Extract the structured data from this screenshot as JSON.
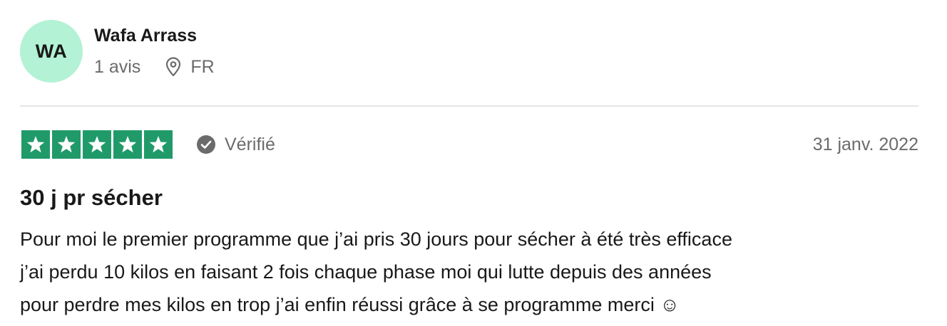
{
  "reviewer": {
    "initials": "WA",
    "name": "Wafa Arrass",
    "review_count": "1 avis",
    "country": "FR",
    "avatar_color": "#b3f2d5"
  },
  "rating": {
    "stars": 5,
    "max_stars": 5,
    "star_color": "#219a6a",
    "verified_label": "Vérifié",
    "date": "31 janv. 2022"
  },
  "review": {
    "title": "30 j pr sécher",
    "lines": [
      "Pour moi le premier programme que j’ai pris 30 jours pour sécher à été très efficace",
      "j’ai perdu 10 kilos en faisant 2 fois chaque phase moi qui lutte depuis des années",
      "pour perdre mes kilos en trop j’ai enfin réussi grâce à se programme merci ☺"
    ]
  },
  "icons": {
    "location": "location-pin-icon",
    "verified": "verified-check-icon",
    "star": "star-icon"
  }
}
